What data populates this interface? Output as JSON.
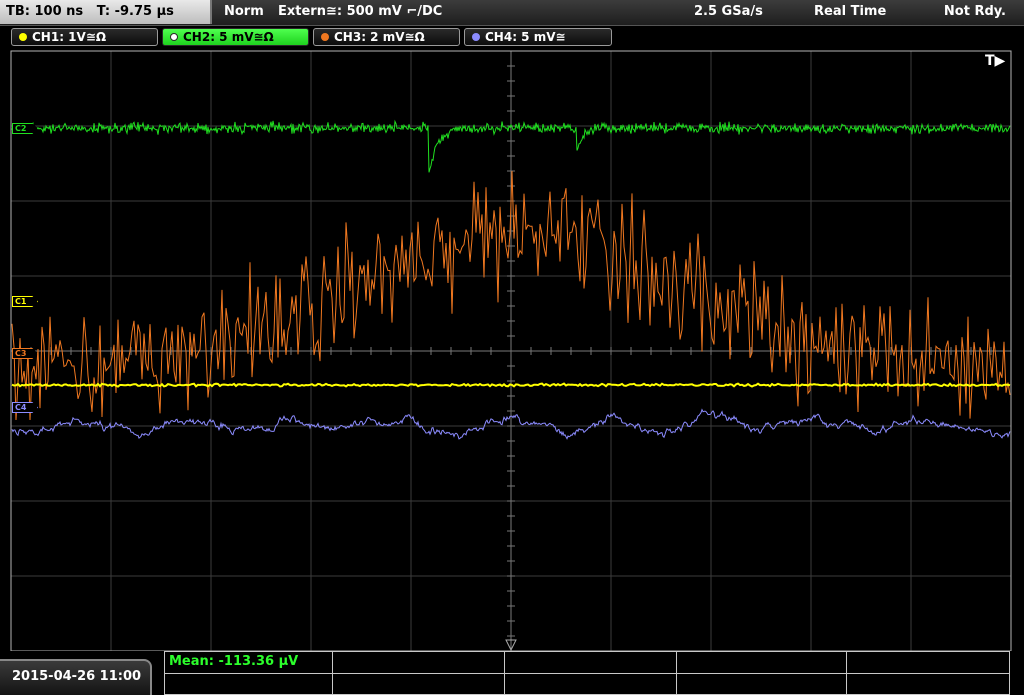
{
  "status_bar": {
    "timebase": "TB: 100 ns",
    "trigger_time": "T: -9.75 µs",
    "trigger_mode": "Norm",
    "trigger_source": "Extern≅: 500 mV ⌐/DC",
    "sample_rate": "2.5 GSa/s",
    "acquisition_mode": "Real Time",
    "ready_state": "Not Rdy."
  },
  "channels": [
    {
      "id": "CH1",
      "label": "CH1: 1V≅Ω",
      "marker": "C1",
      "color": "#ffff00"
    },
    {
      "id": "CH2",
      "label": "CH2: 5 mV≅Ω",
      "marker": "C2",
      "color": "#20e020"
    },
    {
      "id": "CH3",
      "label": "CH3: 2 mV≅Ω",
      "marker": "C3",
      "color": "#f07820"
    },
    {
      "id": "CH4",
      "label": "CH4: 5 mV≅",
      "marker": "C4",
      "color": "#8c8cff"
    }
  ],
  "trigger_position_label": "T▶",
  "datetime": "2015-04-26 11:00",
  "measurement": {
    "label": "Mean: -113.36 µV"
  },
  "colors": {
    "background": "#000000",
    "grid": "#3c3c3c",
    "active_tab": "#33e833"
  }
}
